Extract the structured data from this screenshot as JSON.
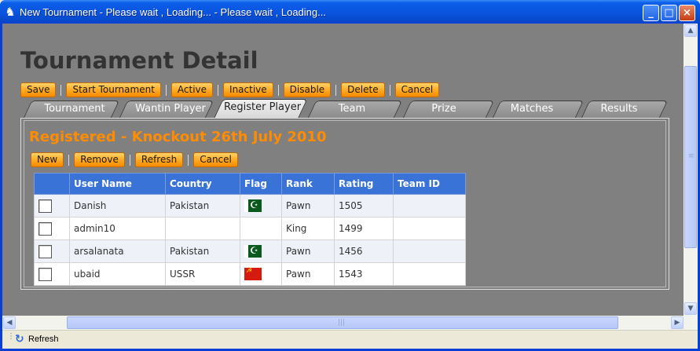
{
  "window": {
    "title": "New Tournament - Please wait , Loading...  - Please wait , Loading...",
    "icon": "chess-knight-icon",
    "buttons": [
      "minimize",
      "maximize",
      "close"
    ]
  },
  "page": {
    "heading": "Tournament Detail",
    "toolbar": [
      "Save",
      "Start Tournament",
      "Active",
      "Inactive",
      "Disable",
      "Delete",
      "Cancel"
    ],
    "tabs": [
      {
        "label": "Tournament",
        "active": false
      },
      {
        "label": "Wantin Player",
        "active": false
      },
      {
        "label": "Register Player",
        "active": true
      },
      {
        "label": "Team",
        "active": false
      },
      {
        "label": "Prize",
        "active": false
      },
      {
        "label": "Matches",
        "active": false
      },
      {
        "label": "Results",
        "active": false
      }
    ],
    "subtitle": "Registered - Knockout 26th July 2010",
    "grid_toolbar": [
      "New",
      "Remove",
      "Refresh",
      "Cancel"
    ]
  },
  "table": {
    "columns": [
      "",
      "User Name",
      "Country",
      "Flag",
      "Rank",
      "Rating",
      "Team ID"
    ],
    "rows": [
      {
        "user": "Danish",
        "country": "Pakistan",
        "flag": "pk",
        "rank": "Pawn",
        "rating": "1505",
        "team": ""
      },
      {
        "user": "admin10",
        "country": "",
        "flag": "",
        "rank": "King",
        "rating": "1499",
        "team": ""
      },
      {
        "user": "arsalanata",
        "country": "Pakistan",
        "flag": "pk",
        "rank": "Pawn",
        "rating": "1456",
        "team": ""
      },
      {
        "user": "ubaid",
        "country": "USSR",
        "flag": "ussr",
        "rank": "Pawn",
        "rating": "1543",
        "team": ""
      }
    ]
  },
  "status": {
    "refresh_label": "Refresh"
  },
  "colors": {
    "accent_orange": "#ff8c00",
    "header_blue": "#3a73d8",
    "content_gray": "#808080"
  }
}
